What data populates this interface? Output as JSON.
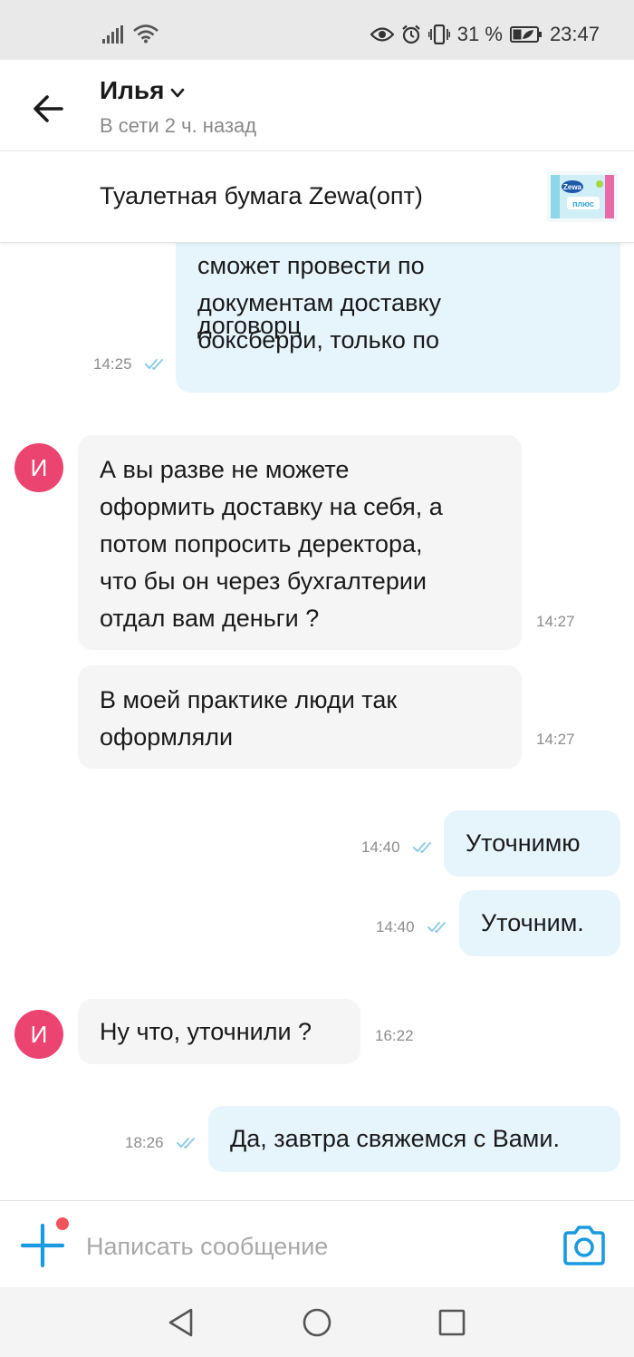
{
  "status_bar": {
    "battery": "31 %",
    "time": "23:47",
    "icons": [
      "signal-icon",
      "wifi-icon",
      "eye-icon",
      "alarm-icon",
      "vibrate-icon",
      "battery-icon"
    ]
  },
  "header": {
    "contact_name": "Илья",
    "status": "В сети 2 ч. назад"
  },
  "item": {
    "title": "Туалетная бумага Zewa(опт)",
    "thumb_brand": "Zewa",
    "thumb_sub": "плюс"
  },
  "messages": [
    {
      "direction": "out",
      "lines": [
        "сможет провести по",
        "документам доставку",
        "боксберри, только по",
        "договорц"
      ],
      "time": "14:25"
    },
    {
      "direction": "in",
      "avatar": "И",
      "lines": [
        "А вы разве не можете",
        "оформить доставку на себя, а",
        "потом попросить деректора,",
        "что бы он через бухгалтерии",
        "отдал вам деньги ?"
      ],
      "time": "14:27"
    },
    {
      "direction": "in",
      "lines": [
        "В моей практике люди так",
        "оформляли"
      ],
      "time": "14:27"
    },
    {
      "direction": "out",
      "lines": [
        "Уточнимю"
      ],
      "time": "14:40"
    },
    {
      "direction": "out",
      "lines": [
        "Уточним."
      ],
      "time": "14:40"
    },
    {
      "direction": "in",
      "avatar": "И",
      "lines": [
        "Ну что, уточнили ?"
      ],
      "time": "16:22"
    },
    {
      "direction": "out",
      "lines": [
        "Да, завтра свяжемся с Вами."
      ],
      "time": "18:26"
    }
  ],
  "composer": {
    "placeholder": "Написать сообщение"
  },
  "colors": {
    "accent": "#1a9ae0",
    "outgoing_bubble": "#e6f5fc",
    "incoming_bubble": "#f5f5f5",
    "avatar": "#ec4470",
    "read_ticks": "#8fcbe9",
    "notification_dot": "#f2545b"
  }
}
